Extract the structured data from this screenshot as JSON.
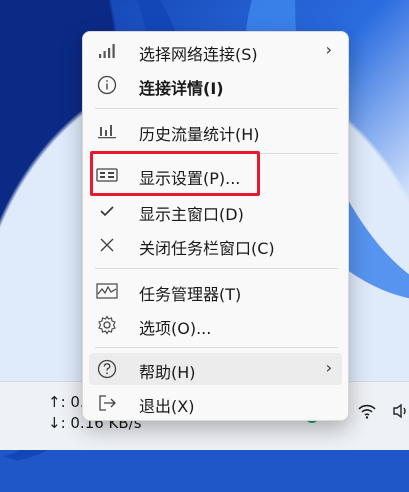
{
  "menu": {
    "items": [
      {
        "label": "选择网络连接(S)",
        "icon": "signal-bars-icon",
        "submenu": true
      },
      {
        "label": "连接详情(I)",
        "icon": "info-icon",
        "bold": true
      },
      {
        "label": "历史流量统计(H)",
        "icon": "bar-chart-icon"
      },
      {
        "label": "显示设置(P)...",
        "icon": "display-settings-icon",
        "highlighted": true
      },
      {
        "label": "显示主窗口(D)",
        "icon": "checkmark-icon",
        "checked": true
      },
      {
        "label": "关闭任务栏窗口(C)",
        "icon": "close-icon"
      },
      {
        "label": "任务管理器(T)",
        "icon": "task-manager-icon"
      },
      {
        "label": "选项(O)...",
        "icon": "gear-icon"
      },
      {
        "label": "帮助(H)",
        "icon": "help-icon",
        "submenu": true,
        "hovered": true
      },
      {
        "label": "退出(X)",
        "icon": "exit-icon"
      }
    ]
  },
  "taskbar": {
    "upload": "↑: 0.",
    "download": "↓: 0.16 KB/s"
  },
  "colors": {
    "highlight_border": "#e8192c",
    "menu_bg": "#f9f9f9",
    "tray_green": "#21a55a"
  }
}
